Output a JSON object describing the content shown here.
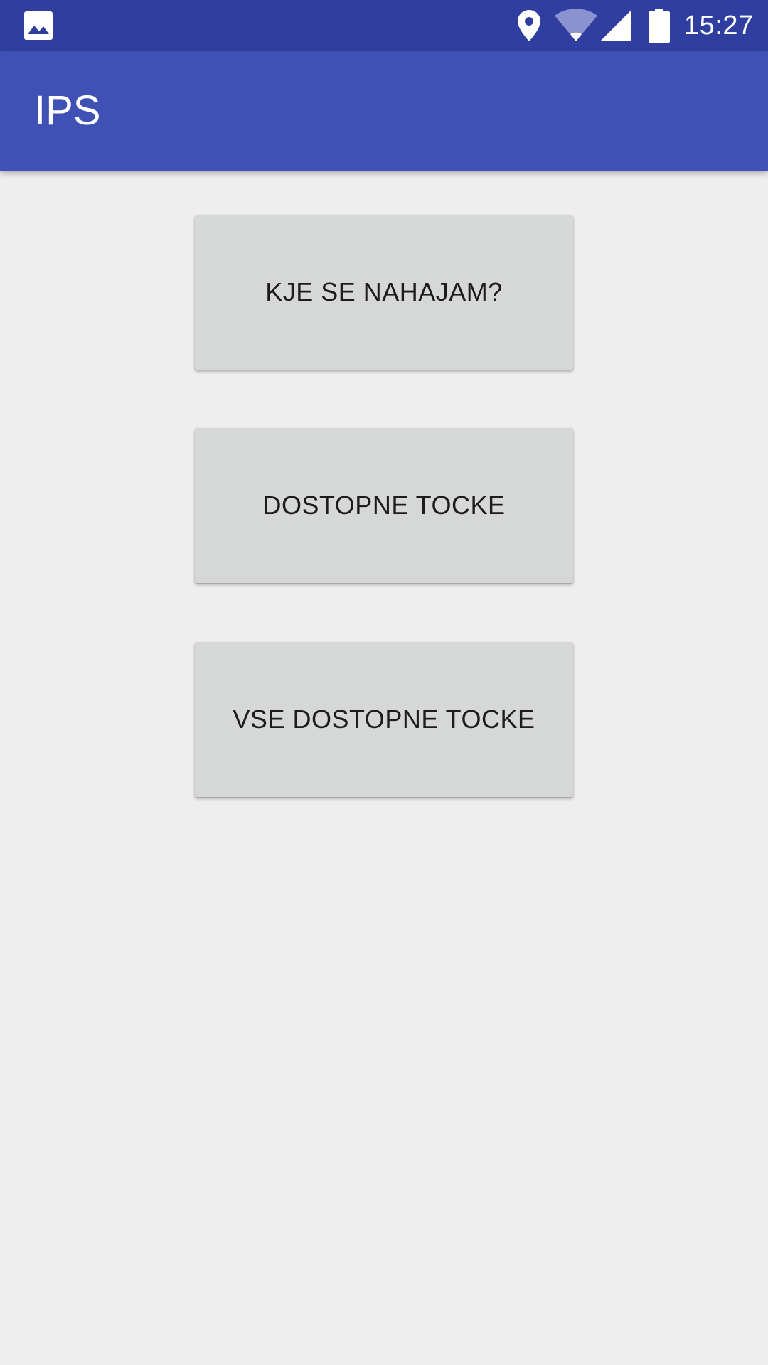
{
  "status_bar": {
    "time": "15:27",
    "icons": [
      "image-icon",
      "location-pin-icon",
      "wifi-icon",
      "cell-signal-icon",
      "battery-icon"
    ]
  },
  "app_bar": {
    "title": "IPS"
  },
  "buttons": [
    {
      "label": "KJE SE NAHAJAM?"
    },
    {
      "label": "DOSTOPNE TOCKE"
    },
    {
      "label": "VSE DOSTOPNE TOCKE"
    }
  ],
  "colors": {
    "status_bar": "#303f9f",
    "app_bar": "#3f51b5",
    "background": "#eeeeee",
    "button": "#d6d7d7",
    "button_text": "#1c1c1c"
  }
}
